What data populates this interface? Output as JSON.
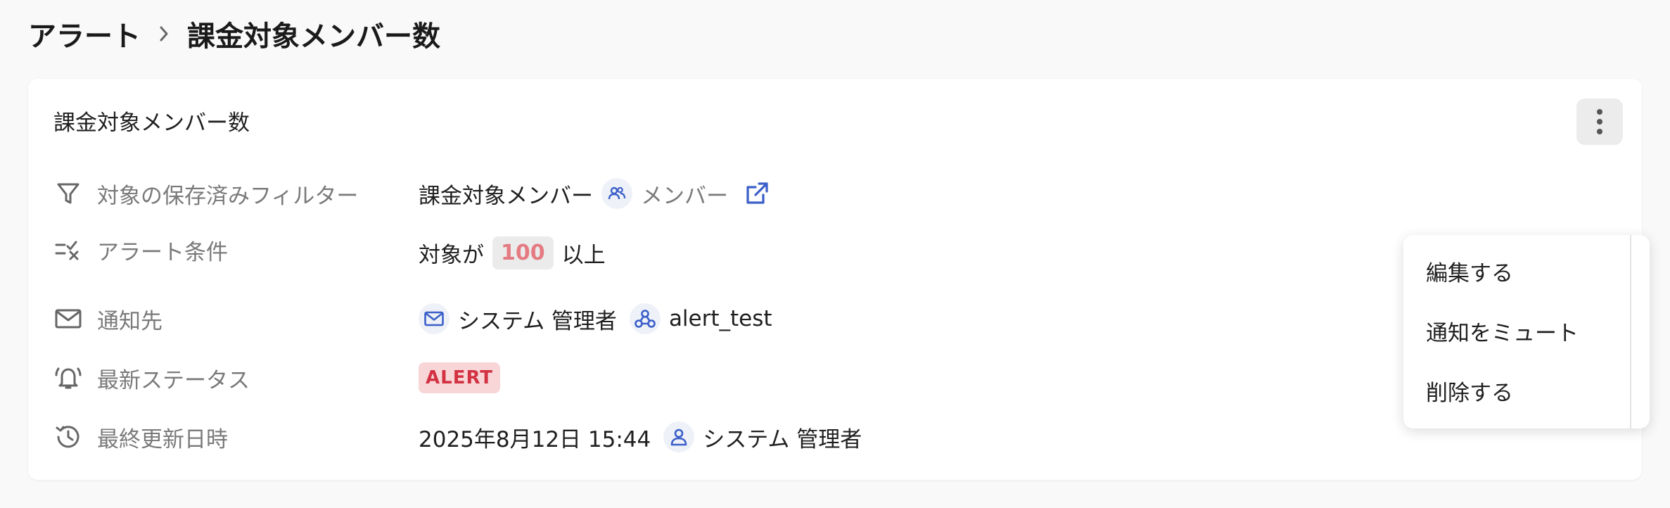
{
  "breadcrumb": {
    "parent": "アラート",
    "current": "課金対象メンバー数"
  },
  "card": {
    "title": "課金対象メンバー数",
    "rows": {
      "filter": {
        "label": "対象の保存済みフィルター",
        "name": "課金対象メンバー",
        "type": "メンバー"
      },
      "condition": {
        "label": "アラート条件",
        "prefix": "対象が",
        "threshold": "100",
        "suffix": "以上"
      },
      "notify": {
        "label": "通知先",
        "email_target": "システム 管理者",
        "webhook_target": "alert_test"
      },
      "status": {
        "label": "最新ステータス",
        "value": "ALERT"
      },
      "updated": {
        "label": "最終更新日時",
        "datetime": "2025年8月12日 15:44",
        "user": "システム 管理者"
      }
    }
  },
  "menu": {
    "edit": "編集する",
    "mute": "通知をミュート",
    "delete": "削除する"
  },
  "colors": {
    "accent": "#3a5fc8",
    "alert_text": "#d23242",
    "alert_bg": "#f8d6d8",
    "threshold_text": "#e57b82"
  }
}
